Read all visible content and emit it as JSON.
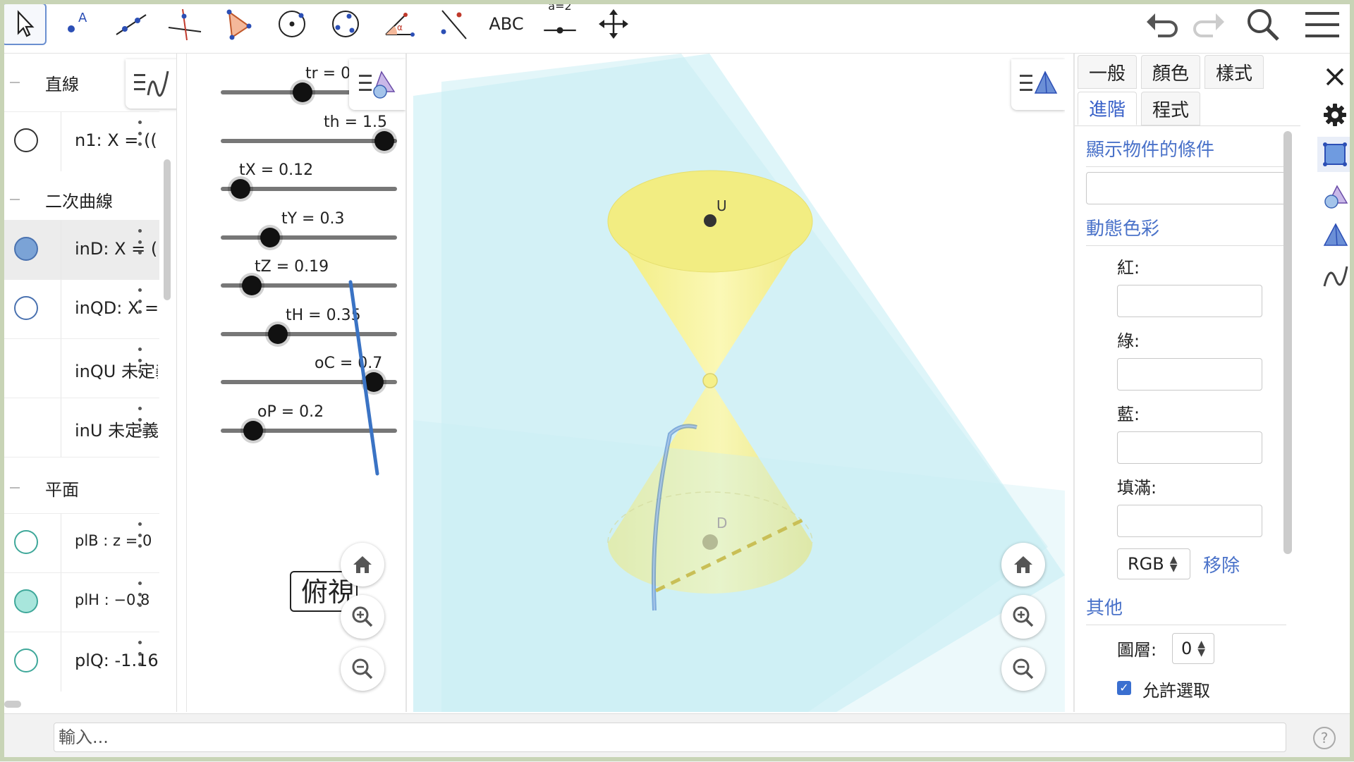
{
  "toolbar": {
    "tools": [
      {
        "name": "move-tool",
        "icon": "cursor-arrow-icon",
        "selected": true
      },
      {
        "name": "point-tool",
        "icon": "point-icon"
      },
      {
        "name": "line-tool",
        "icon": "line-icon"
      },
      {
        "name": "perpendicular-tool",
        "icon": "perpendicular-line-icon"
      },
      {
        "name": "polygon-tool",
        "icon": "triangle-icon"
      },
      {
        "name": "circle-tool",
        "icon": "circle-center-icon"
      },
      {
        "name": "conic-tool",
        "icon": "ellipse-icon"
      },
      {
        "name": "angle-tool",
        "icon": "angle-icon"
      },
      {
        "name": "reflect-tool",
        "icon": "reflect-line-icon"
      },
      {
        "name": "text-tool",
        "label": "ABC"
      },
      {
        "name": "slider-tool",
        "label": "a=2"
      },
      {
        "name": "move-view-tool",
        "icon": "move-arrows-icon"
      }
    ],
    "right": [
      "undo-icon",
      "redo-icon",
      "search-icon",
      "menu-icon"
    ]
  },
  "algebra": {
    "groups": [
      {
        "label": "直線",
        "items": [
          {
            "def": "n1: X = (( ",
            "marble": "empty"
          }
        ]
      },
      {
        "label": "二次曲線",
        "items": [
          {
            "def": "inD: X = (",
            "marble": "blue",
            "selected": true
          },
          {
            "def": "inQD: X = ",
            "marble": "empty-blue"
          },
          {
            "def": "inQU 未定義",
            "marble": "none"
          },
          {
            "def": "inU 未定義",
            "marble": "none"
          }
        ]
      },
      {
        "label": "平面",
        "items": [
          {
            "def": "plB : z = 0",
            "marble": "empty-teal"
          },
          {
            "def": "plH : −0.8",
            "marble": "teal"
          },
          {
            "def": "plQ: -1.16:",
            "marble": "empty-teal"
          }
        ]
      }
    ]
  },
  "sliders": [
    {
      "label": "tr = 0",
      "value": 0,
      "min": -10,
      "max": 10
    },
    {
      "label": "th = 1.5",
      "value": 1.5,
      "min": 0,
      "max": 1.5
    },
    {
      "label": "tX = 0.12",
      "value": 0.12,
      "min": 0,
      "max": 1
    },
    {
      "label": "tY = 0.3",
      "value": 0.3,
      "min": 0,
      "max": 1
    },
    {
      "label": "tZ = 0.19",
      "value": 0.19,
      "min": 0,
      "max": 1
    },
    {
      "label": "tH = 0.35",
      "value": 0.35,
      "min": 0,
      "max": 1
    },
    {
      "label": "oC = 0.7",
      "value": 0.7,
      "min": 0,
      "max": 0.75
    },
    {
      "label": "oP = 0.2",
      "value": 0.2,
      "min": 0,
      "max": 1
    }
  ],
  "view_button": {
    "label": "俯視"
  },
  "graphics3d": {
    "points": [
      {
        "label": "U"
      },
      {
        "label": "D"
      }
    ],
    "colors": {
      "cone": "#f5f08a",
      "plane": "#cdeff5",
      "curve": "#3a73c4"
    }
  },
  "properties": {
    "tabs": [
      "一般",
      "顏色",
      "樣式",
      "進階",
      "程式"
    ],
    "active_tab": "進階",
    "sections": {
      "condition": "顯示物件的條件",
      "dynamic_color": "動態色彩",
      "other": "其他"
    },
    "fields": {
      "red": "紅:",
      "green": "綠:",
      "blue": "藍:",
      "fill": "填滿:"
    },
    "color_space": "RGB",
    "remove": "移除",
    "layer_label": "圖層:",
    "layer_value": "0",
    "allow_select": "允許選取"
  },
  "input_bar": {
    "placeholder": "輸入..."
  }
}
